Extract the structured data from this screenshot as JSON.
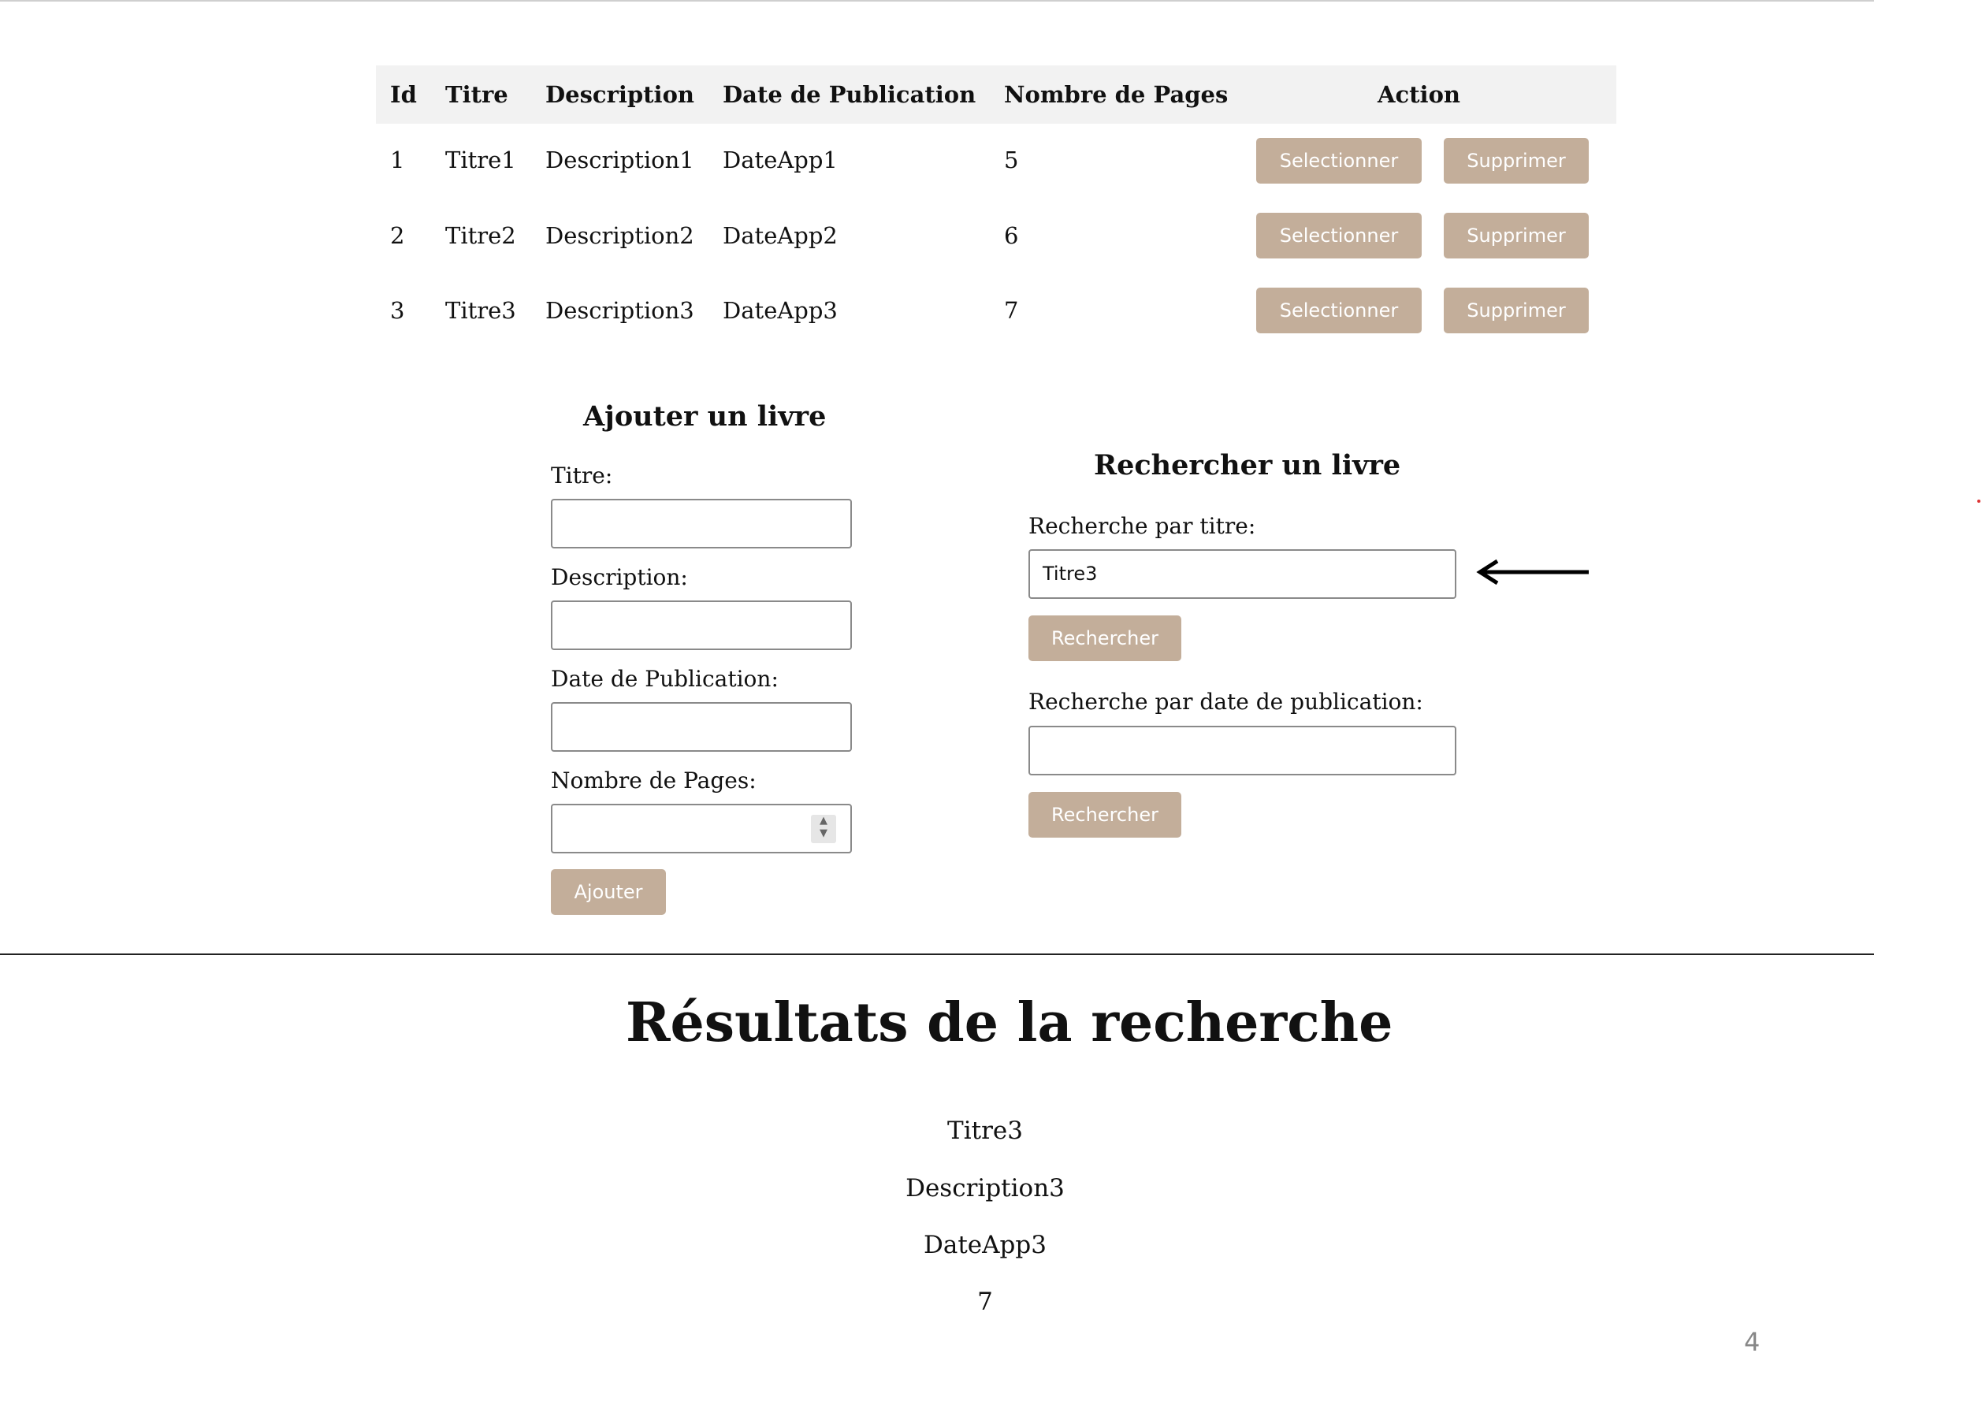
{
  "table": {
    "headers": [
      "Id",
      "Titre",
      "Description",
      "Date de Publication",
      "Nombre de Pages",
      "Action"
    ],
    "rows": [
      {
        "id": "1",
        "titre": "Titre1",
        "description": "Description1",
        "date": "DateApp1",
        "pages": "5",
        "select_label": "Selectionner",
        "delete_label": "Supprimer"
      },
      {
        "id": "2",
        "titre": "Titre2",
        "description": "Description2",
        "date": "DateApp2",
        "pages": "6",
        "select_label": "Selectionner",
        "delete_label": "Supprimer"
      },
      {
        "id": "3",
        "titre": "Titre3",
        "description": "Description3",
        "date": "DateApp3",
        "pages": "7",
        "select_label": "Selectionner",
        "delete_label": "Supprimer"
      }
    ]
  },
  "add_form": {
    "title": "Ajouter un livre",
    "titre_label": "Titre:",
    "titre_value": "",
    "description_label": "Description:",
    "description_value": "",
    "date_label": "Date de Publication:",
    "date_value": "",
    "pages_label": "Nombre de Pages:",
    "pages_value": "",
    "submit_label": "Ajouter"
  },
  "search_form": {
    "title": "Rechercher un livre",
    "by_title_label": "Recherche par titre:",
    "by_title_value": "Titre3",
    "by_title_button": "Rechercher",
    "by_date_label": "Recherche par date de publication:",
    "by_date_value": "",
    "by_date_button": "Rechercher"
  },
  "results": {
    "title": "Résultats de la recherche",
    "titre": "Titre3",
    "description": "Description3",
    "date": "DateApp3",
    "pages": "7"
  },
  "page_number": "4",
  "colors": {
    "button": "#c3ae9a",
    "header_bg": "#f2f2f2"
  }
}
